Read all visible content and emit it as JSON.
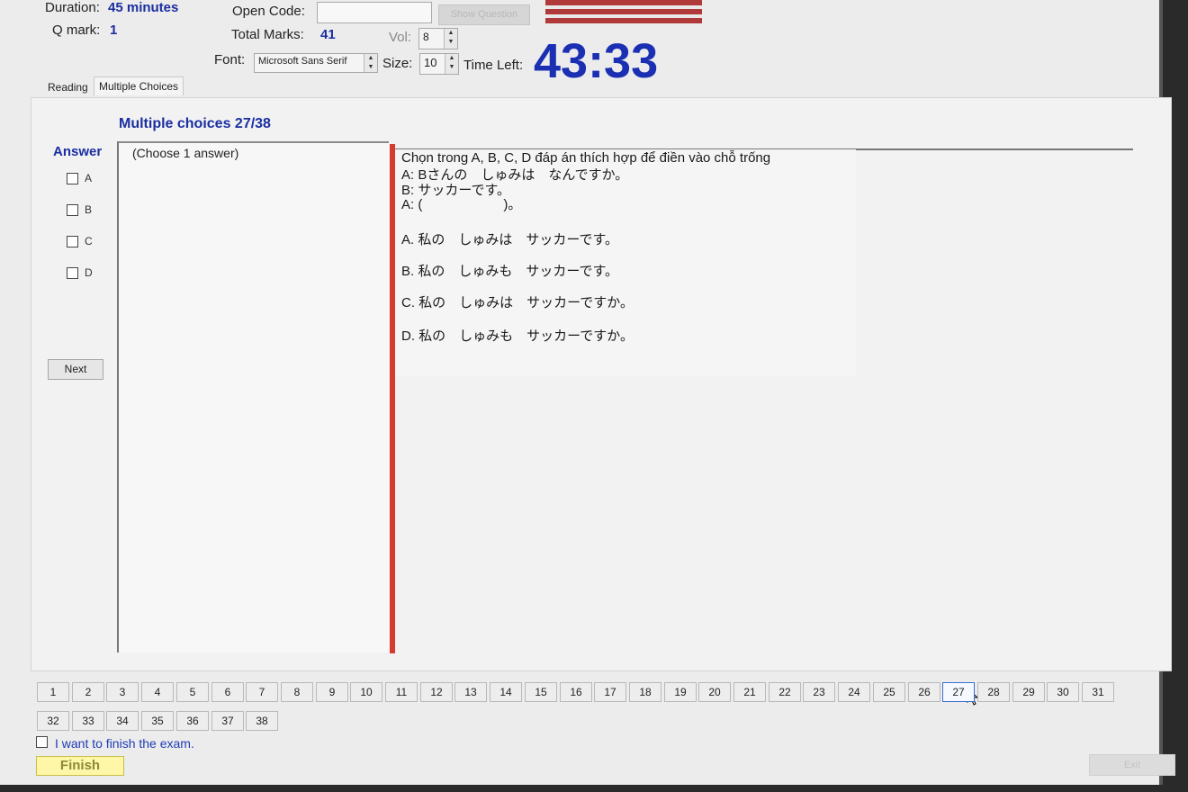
{
  "header": {
    "duration_label": "Duration:",
    "duration_value": "45 minutes",
    "qmark_label": "Q mark:",
    "qmark_value": "1",
    "open_code_label": "Open Code:",
    "open_code_value": "",
    "show_question_label": "Show Question",
    "total_marks_label": "Total Marks:",
    "total_marks_value": "41",
    "vol_label": "Vol:",
    "vol_value": "8",
    "font_label": "Font:",
    "font_value": "Microsoft Sans Serif",
    "size_label": "Size:",
    "size_value": "10",
    "time_left_label": "Time Left:",
    "time_left_value": "43:33"
  },
  "tabs": [
    {
      "label": "Reading",
      "active": false
    },
    {
      "label": "Multiple Choices",
      "active": true
    }
  ],
  "main": {
    "section_title": "Multiple choices 27/38",
    "answer_heading": "Answer",
    "options": [
      "A",
      "B",
      "C",
      "D"
    ],
    "choose_hint": "(Choose 1 answer)",
    "next_label": "Next",
    "question": {
      "instruction": "Chọn trong A, B, C, D đáp án thích hợp để điền vào chỗ trống",
      "dialog": [
        "A:  Bさんの　しゅみは　なんですか。",
        "B:  サッカーです。",
        "A: (　　　　　　)。"
      ],
      "answers": [
        "A. 私の　しゅみは　サッカーです。",
        "B. 私の　しゅみも　サッカーです。",
        "C. 私の　しゅみは　サッカーですか。",
        "D. 私の　しゅみも　サッカーですか。"
      ]
    }
  },
  "navigation": {
    "current": "27",
    "row1": [
      "1",
      "2",
      "3",
      "4",
      "5",
      "6",
      "7",
      "8",
      "9",
      "10",
      "11",
      "12",
      "13",
      "14",
      "15",
      "16",
      "17",
      "18",
      "19",
      "20",
      "21",
      "22",
      "23",
      "24",
      "25",
      "26",
      "27",
      "28",
      "29",
      "30",
      "31"
    ],
    "row2": [
      "32",
      "33",
      "34",
      "35",
      "36",
      "37",
      "38"
    ]
  },
  "footer": {
    "finish_checkbox_label": "I want to finish the exam.",
    "finish_label": "Finish",
    "exit_label": "Exit"
  },
  "colors": {
    "accent_blue": "#1a2ea0",
    "timer_blue": "#1b2fb3",
    "red_bar": "#d63b2f",
    "finish_yellow": "#fff7a8"
  }
}
